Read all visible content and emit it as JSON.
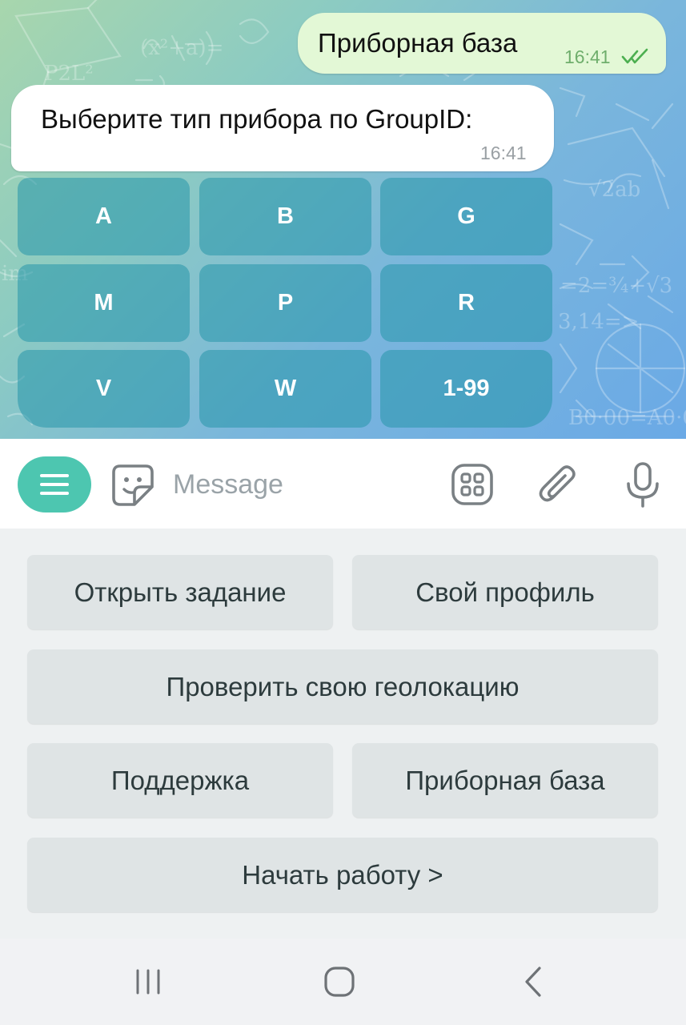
{
  "chat": {
    "outgoing": {
      "text": "Приборная база",
      "time": "16:41",
      "status_icon": "double-check-icon"
    },
    "incoming": {
      "text": "Выберите тип прибора по GroupID:",
      "time": "16:41"
    },
    "inline_keyboard": [
      [
        "A",
        "B",
        "G"
      ],
      [
        "M",
        "P",
        "R"
      ],
      [
        "V",
        "W",
        "1-99"
      ]
    ],
    "colors": {
      "outgoing_bubble": "#e3f8d6",
      "inline_button": "#2696aa"
    }
  },
  "input_bar": {
    "placeholder": "Message",
    "icons": [
      "menu-icon",
      "sticker-icon",
      "keyboard-toggle-icon",
      "attach-icon",
      "mic-icon"
    ],
    "accent": "#4dc6b0"
  },
  "reply_keyboard": {
    "open_task": "Открыть задание",
    "my_profile": "Свой профиль",
    "check_geolocation": "Проверить свою геолокацию",
    "support": "Поддержка",
    "device_base": "Приборная база",
    "start_work": "Начать работу >"
  },
  "nav_bar": {
    "icons": [
      "recents-icon",
      "home-icon",
      "back-icon"
    ]
  }
}
